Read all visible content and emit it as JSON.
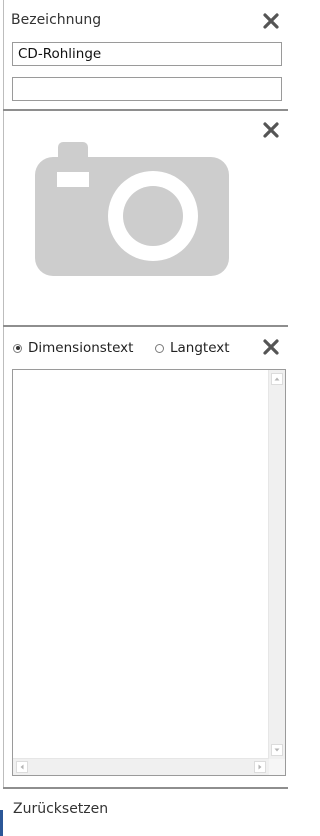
{
  "title_section": {
    "label": "Bezeichnung",
    "name_value": "CD-Rohlinge",
    "second_value": "",
    "close_icon": "close-icon"
  },
  "image_section": {
    "placeholder_icon": "camera-icon",
    "close_icon": "close-icon"
  },
  "text_section": {
    "radio_options": [
      {
        "label": "Dimensionstext",
        "selected": true
      },
      {
        "label": "Langtext",
        "selected": false
      }
    ],
    "text_value": "",
    "close_icon": "close-icon"
  },
  "footer": {
    "reset_label": "Zurücksetzen"
  },
  "colors": {
    "camera": "#cdcdcd",
    "close": "#555555",
    "accent": "#2b5797"
  }
}
